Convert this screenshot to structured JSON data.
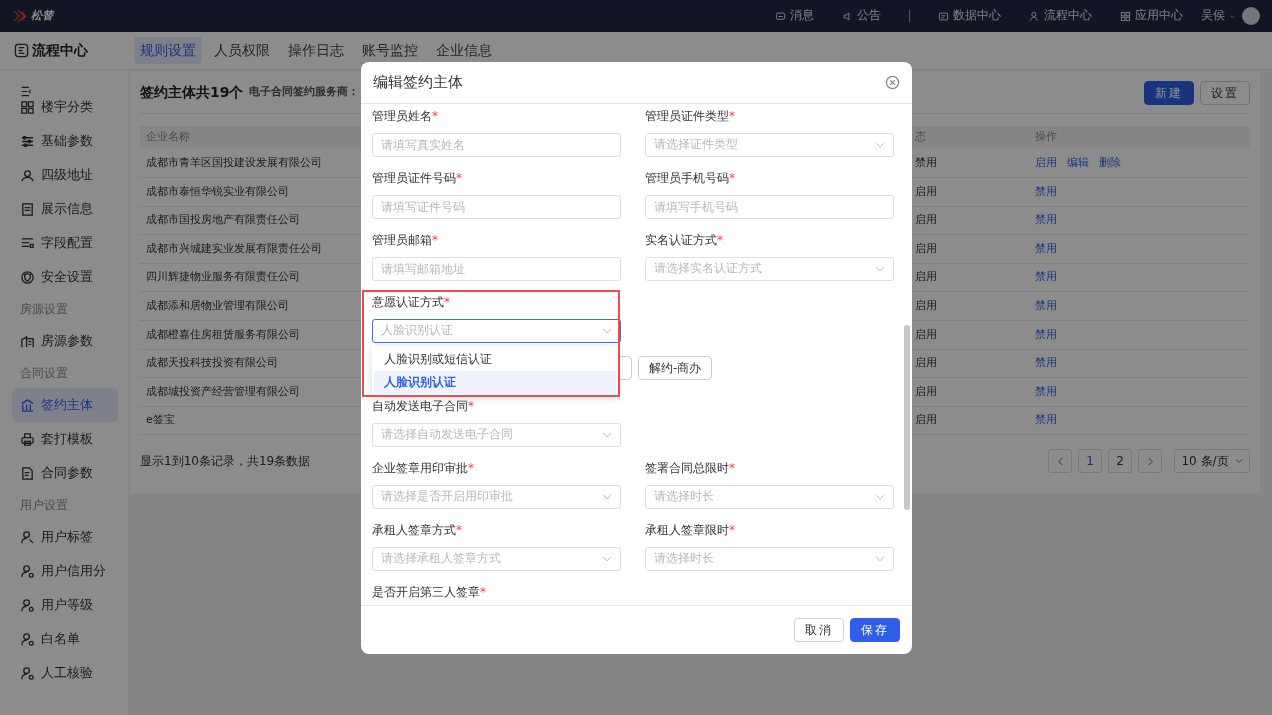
{
  "top_bar": {
    "logo": "松替",
    "items": [
      {
        "label": "消息"
      },
      {
        "label": "公告"
      },
      {
        "label": "数据中心"
      },
      {
        "label": "流程中心"
      },
      {
        "label": "应用中心"
      }
    ],
    "user": "吴侯"
  },
  "module": {
    "title": "流程中心",
    "tabs": [
      {
        "label": "规则设置",
        "selected": true
      },
      {
        "label": "人员权限",
        "selected": false
      },
      {
        "label": "操作日志",
        "selected": false
      },
      {
        "label": "账号监控",
        "selected": false
      },
      {
        "label": "企业信息",
        "selected": false
      }
    ]
  },
  "sidebar": {
    "items": [
      {
        "kind": "item",
        "label": "楼宇分类",
        "selected": false
      },
      {
        "kind": "item",
        "label": "基础参数",
        "selected": false
      },
      {
        "kind": "item",
        "label": "四级地址",
        "selected": false
      },
      {
        "kind": "item",
        "label": "展示信息",
        "selected": false
      },
      {
        "kind": "item",
        "label": "字段配置",
        "selected": false
      },
      {
        "kind": "item",
        "label": "安全设置",
        "selected": false
      },
      {
        "kind": "group",
        "label": "房源设置"
      },
      {
        "kind": "item",
        "label": "房源参数",
        "selected": false
      },
      {
        "kind": "group",
        "label": "合同设置"
      },
      {
        "kind": "item",
        "label": "签约主体",
        "selected": true
      },
      {
        "kind": "item",
        "label": "套打模板",
        "selected": false
      },
      {
        "kind": "item",
        "label": "合同参数",
        "selected": false
      },
      {
        "kind": "group",
        "label": "用户设置"
      },
      {
        "kind": "item",
        "label": "用户标签",
        "selected": false
      },
      {
        "kind": "item",
        "label": "用户信用分",
        "selected": false
      },
      {
        "kind": "item",
        "label": "用户等级",
        "selected": false
      },
      {
        "kind": "item",
        "label": "白名单",
        "selected": false
      },
      {
        "kind": "item",
        "label": "人工核验",
        "selected": false
      }
    ]
  },
  "content": {
    "title": "签约主体共19个",
    "subtitle": "电子合同签约服务商：",
    "buttons": [
      {
        "label": "新建",
        "kind": "primary"
      },
      {
        "label": "设置",
        "kind": "default"
      }
    ],
    "table": {
      "columns": [
        "企业名称",
        "态",
        "操作"
      ],
      "rows": [
        {
          "name": "成都市青羊区国投建设发展有限公司",
          "status": "禁用",
          "actions": [
            "启用",
            "编辑",
            "删除"
          ]
        },
        {
          "name": "成都市泰恒华锐实业有限公司",
          "status": "启用",
          "actions": [
            "禁用"
          ]
        },
        {
          "name": "成都市国投房地产有限责任公司",
          "status": "启用",
          "actions": [
            "禁用"
          ]
        },
        {
          "name": "成都市兴城建实业发展有限责任公司",
          "status": "启用",
          "actions": [
            "禁用"
          ]
        },
        {
          "name": "四川辉捷物业服务有限责任公司",
          "status": "启用",
          "actions": [
            "禁用"
          ]
        },
        {
          "name": "成都添和居物业管理有限公司",
          "status": "启用",
          "actions": [
            "禁用"
          ]
        },
        {
          "name": "成都橙嘉住房租赁服务有限公司",
          "status": "启用",
          "actions": [
            "禁用"
          ]
        },
        {
          "name": "成都天投科技投资有限公司",
          "status": "启用",
          "actions": [
            "禁用"
          ]
        },
        {
          "name": "成都城投资产经营管理有限公司",
          "status": "启用",
          "actions": [
            "禁用"
          ]
        },
        {
          "name": "e签宝",
          "status": "启用",
          "actions": [
            "禁用"
          ]
        }
      ]
    },
    "summary": "显示1到10条记录，共19条数据",
    "pagination": {
      "pages": [
        {
          "label": "1",
          "selected": true
        },
        {
          "label": "2",
          "selected": false
        }
      ],
      "page_size": "10 条/页"
    }
  },
  "dialog": {
    "title": "编辑签约主体",
    "rows": [
      {
        "kind": "fields",
        "fields": [
          {
            "label": "管理员姓名",
            "required_mark": "*",
            "kind": "input",
            "placeholder": "请填写真实姓名"
          },
          {
            "label": "管理员证件类型",
            "required_mark": "*",
            "kind": "select",
            "placeholder": "请选择证件类型"
          }
        ]
      },
      {
        "kind": "fields",
        "fields": [
          {
            "label": "管理员证件号码",
            "required_mark": "*",
            "kind": "input",
            "placeholder": "请填写证件号码"
          },
          {
            "label": "管理员手机号码",
            "required_mark": "*",
            "kind": "input",
            "placeholder": "请填写手机号码"
          }
        ]
      },
      {
        "kind": "fields",
        "fields": [
          {
            "label": "管理员邮箱",
            "required_mark": "*",
            "kind": "input",
            "placeholder": "请填写邮箱地址"
          },
          {
            "label": "实名认证方式",
            "required_mark": "*",
            "kind": "select",
            "placeholder": "请选择实名认证方式"
          }
        ]
      },
      {
        "kind": "fields",
        "fields": [
          {
            "label": "意愿认证方式",
            "required_mark": "*",
            "kind": "select",
            "placeholder": "人脸识别认证",
            "focused": true,
            "highlighted": true,
            "open": true,
            "options": [
              {
                "label": "人脸识别或短信认证",
                "selected": false
              },
              {
                "label": "人脸识别认证",
                "selected": true
              }
            ]
          }
        ]
      },
      {
        "kind": "tags",
        "tags": [
          "解约-商办"
        ]
      },
      {
        "kind": "fields",
        "fields": [
          {
            "label": "自动发送电子合同",
            "required_mark": "*",
            "kind": "select",
            "placeholder": "请选择自动发送电子合同"
          }
        ]
      },
      {
        "kind": "fields",
        "fields": [
          {
            "label": "企业签章用印审批",
            "required_mark": "*",
            "kind": "select",
            "placeholder": "请选择是否开启用印审批"
          },
          {
            "label": "签署合同总限时",
            "required_mark": "*",
            "kind": "select",
            "placeholder": "请选择时长"
          }
        ]
      },
      {
        "kind": "fields",
        "fields": [
          {
            "label": "承租人签章方式",
            "required_mark": "*",
            "kind": "select",
            "placeholder": "请选择承租人签章方式"
          },
          {
            "label": "承租人签章限时",
            "required_mark": "*",
            "kind": "select",
            "placeholder": "请选择时长"
          }
        ]
      },
      {
        "kind": "fields",
        "fields": [
          {
            "label": "是否开启第三人签章",
            "required_mark": "*",
            "kind": "label"
          }
        ]
      }
    ],
    "buttons": [
      {
        "label": "取消",
        "kind": "default"
      },
      {
        "label": "保存",
        "kind": "primary"
      }
    ]
  }
}
